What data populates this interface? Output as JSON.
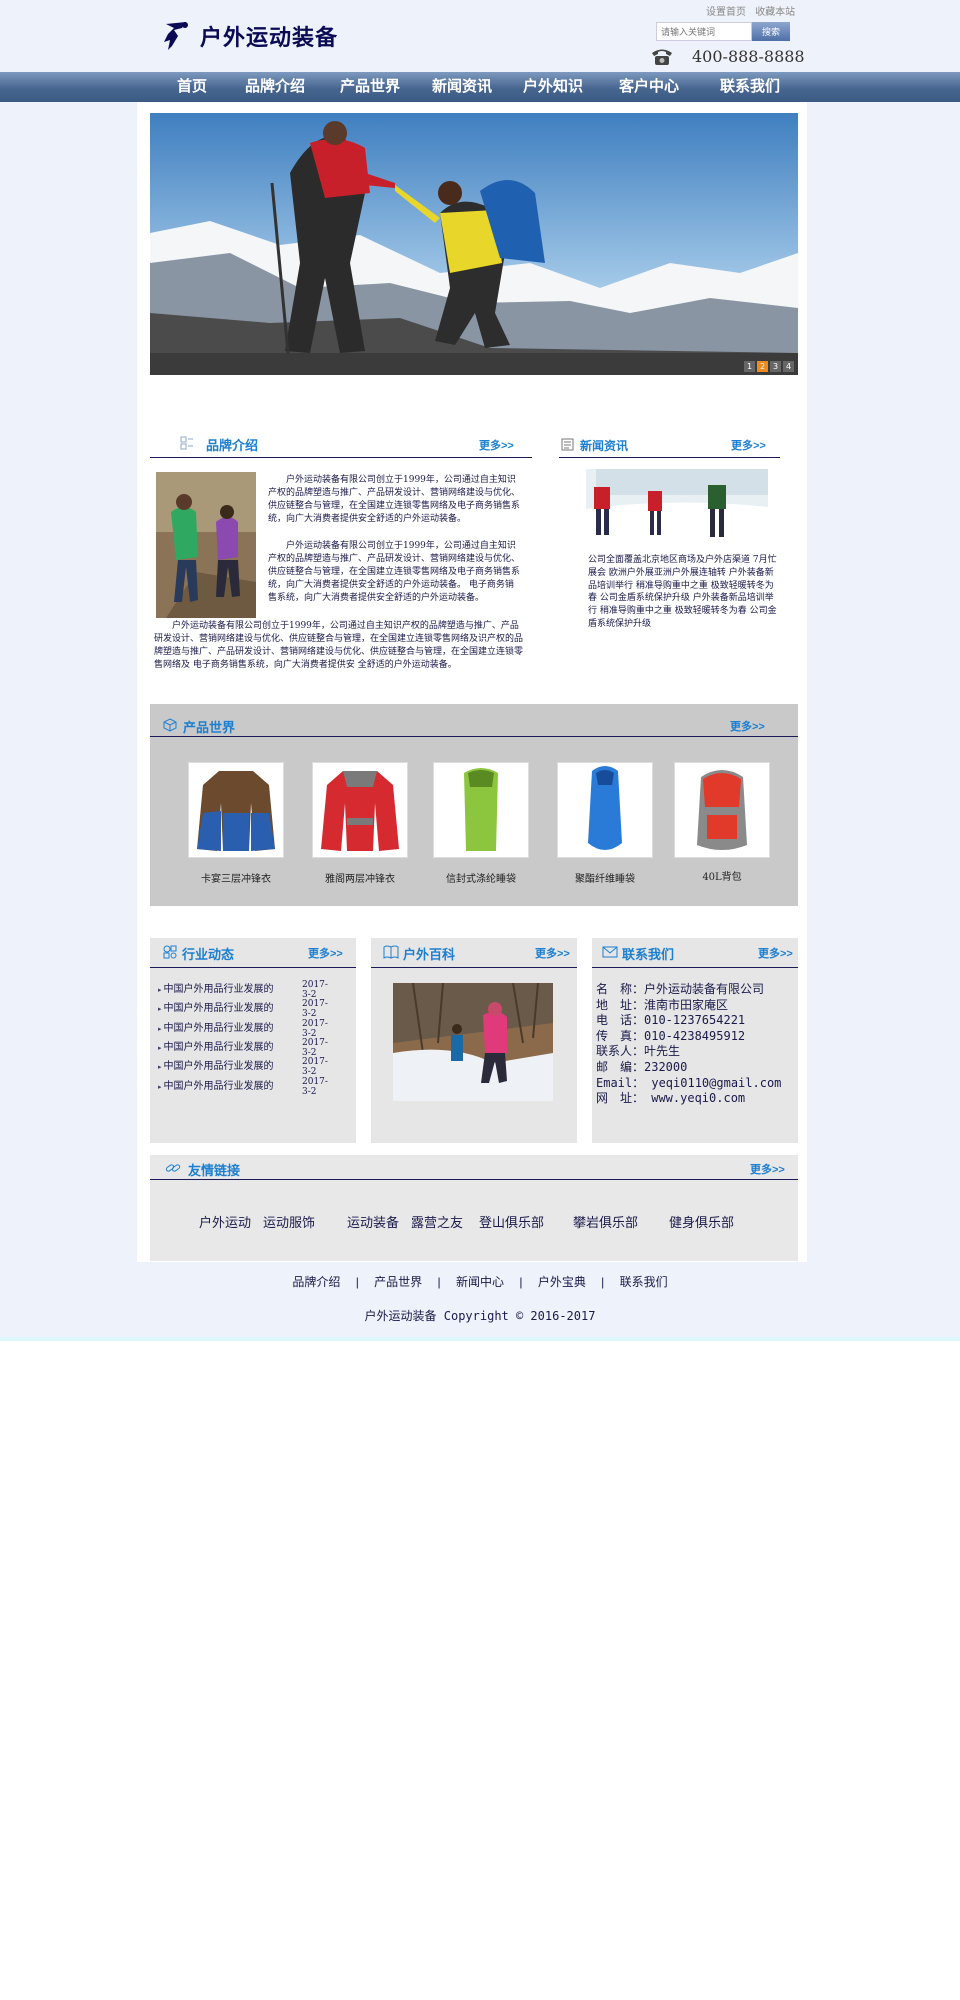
{
  "header": {
    "logo_text": "户外运动装备",
    "set_home": "设置首页",
    "bookmark": "收藏本站",
    "search_placeholder": "请输入关键词",
    "search_button": "搜索",
    "phone": "400-888-8888"
  },
  "nav": [
    "首页",
    "品牌介绍",
    "产品世界",
    "新闻资讯",
    "户外知识",
    "客户中心",
    "联系我们"
  ],
  "banner": {
    "pages": [
      "1",
      "2",
      "3",
      "4"
    ],
    "active_page": "2"
  },
  "brand": {
    "title": "品牌介绍",
    "more": "更多>>",
    "p1": "户外运动装备有限公司创立于1999年，公司通过自主知识产权的品牌塑造与推广、产品研发设计、营销网络建设与优化、供应链整合与管理，在全国建立连锁零售网络及电子商务销售系统，向广大消费者提供安全舒适的户外运动装备。",
    "p2": "户外运动装备有限公司创立于1999年，公司通过自主知识产权的品牌塑造与推广、产品研发设计、营销网络建设与优化、供应链整合与管理，在全国建立连锁零售网络及电子商务销售系统，向广大消费者提供安全舒适的户外运动装备。 电子商务销售系统，向广大消费者提供安全舒适的户外运动装备。",
    "p3": "户外运动装备有限公司创立于1999年，公司通过自主知识产权的品牌塑造与推广、产品研发设计、营销网络建设与优化、供应链整合与管理，在全国建立连锁零售网络及识产权的品牌塑造与推广、产品研发设计、营销网络建设与优化、供应链整合与管理，在全国建立连锁零售网络及 电子商务销售系统，向广大消费者提供安 全舒适的户外运动装备。"
  },
  "news": {
    "title": "新闻资讯",
    "more": "更多>>",
    "text": "公司全面覆盖北京地区商场及户外店渠道 7月忙展会 欧洲户外展亚洲户外展连轴转 户外装备新品培训举行 稍准导购重中之重 极致轻暖转冬为春 公司金盾系统保护升级 户外装备新品培训举行 稍准导购重中之重 极致轻暖转冬为春 公司金盾系统保护升级"
  },
  "products": {
    "title": "产品世界",
    "more": "更多>>",
    "items": [
      {
        "name": "卡宴三层冲锋衣"
      },
      {
        "name": "雅阁两层冲锋衣"
      },
      {
        "name": "信封式涤纶睡袋"
      },
      {
        "name": "聚酯纤维睡袋"
      },
      {
        "name": "40L背包"
      }
    ]
  },
  "industry": {
    "title": "行业动态",
    "more": "更多>>",
    "items": [
      {
        "text": "中国户外用品行业发展的",
        "date": "2017-3-2"
      },
      {
        "text": "中国户外用品行业发展的",
        "date": "2017-3-2"
      },
      {
        "text": "中国户外用品行业发展的",
        "date": "2017-3-2"
      },
      {
        "text": "中国户外用品行业发展的",
        "date": "2017-3-2"
      },
      {
        "text": "中国户外用品行业发展的",
        "date": "2017-3-2"
      },
      {
        "text": "中国户外用品行业发展的",
        "date": "2017-3-2"
      }
    ]
  },
  "encyclopedia": {
    "title": "户外百科",
    "more": "更多>>"
  },
  "contact": {
    "title": "联系我们",
    "more": "更多>>",
    "lines": [
      "名　称：户外运动装备有限公司",
      "地　址：淮南市田家庵区",
      "电　话：010-1237654221",
      "传　真：010-4238495912",
      "联系人：叶先生",
      "邮　编：232000",
      "Email： yeqi0110@gmail.com",
      "网　址： www.yeqi0.com"
    ]
  },
  "friends": {
    "title": "友情链接",
    "more": "更多>>",
    "items": [
      "户外运动",
      "运动服饰",
      "运动装备",
      "露营之友",
      "登山俱乐部",
      "攀岩俱乐部",
      "健身俱乐部"
    ]
  },
  "footer": {
    "links": [
      "品牌介绍",
      "|",
      "产品世界",
      "|",
      "新闻中心",
      "|",
      "户外宝典",
      "|",
      "联系我们"
    ],
    "copyright": "户外运动装备 Copyright © 2016-2017"
  }
}
